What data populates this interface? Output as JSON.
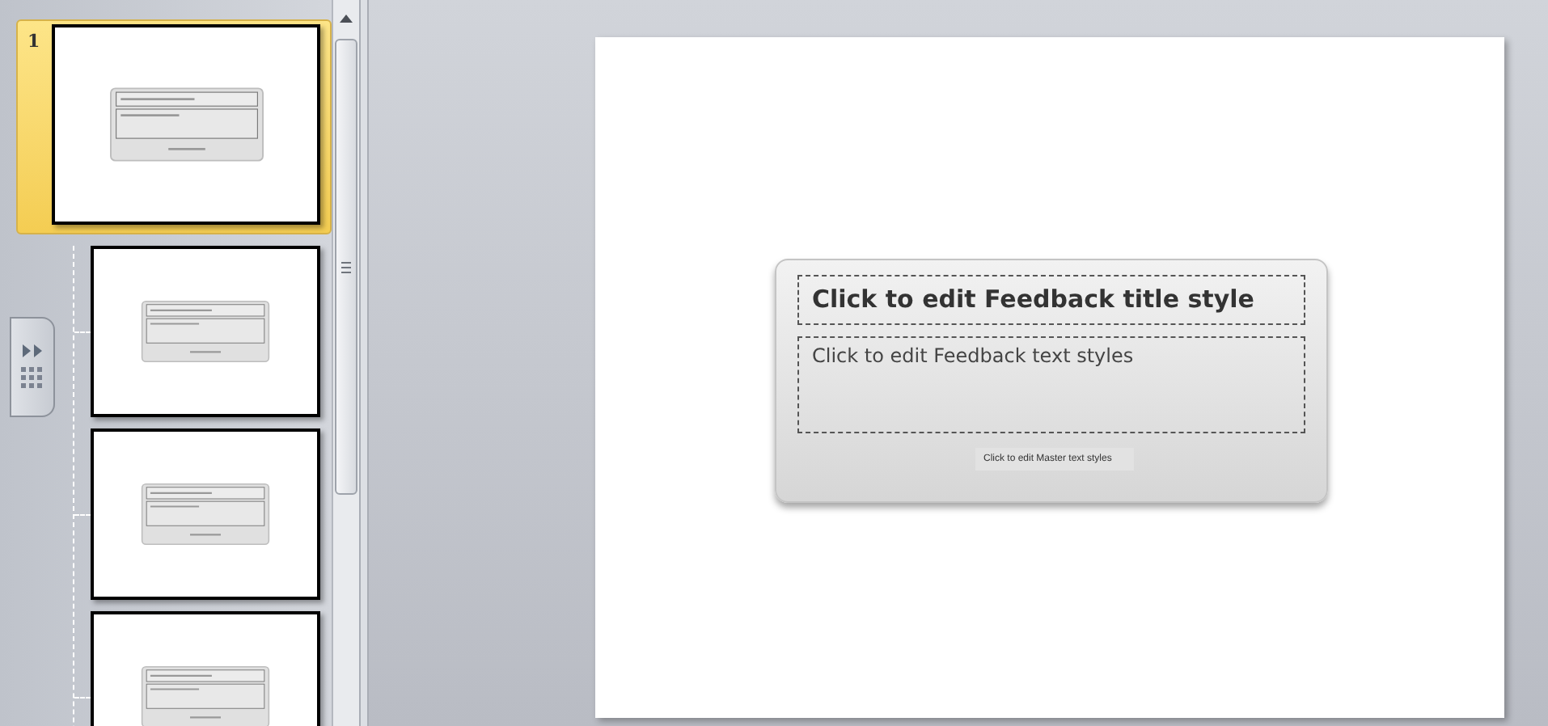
{
  "slides_panel": {
    "slides": [
      {
        "number": "1",
        "selected": true,
        "children": [
          {
            "selected": false
          },
          {
            "selected": false
          },
          {
            "selected": false
          }
        ]
      }
    ]
  },
  "slide": {
    "callout": {
      "title": "Click to edit Feedback title style",
      "body": "Click to edit Feedback text styles",
      "footer": "Click to edit Master text styles"
    }
  }
}
